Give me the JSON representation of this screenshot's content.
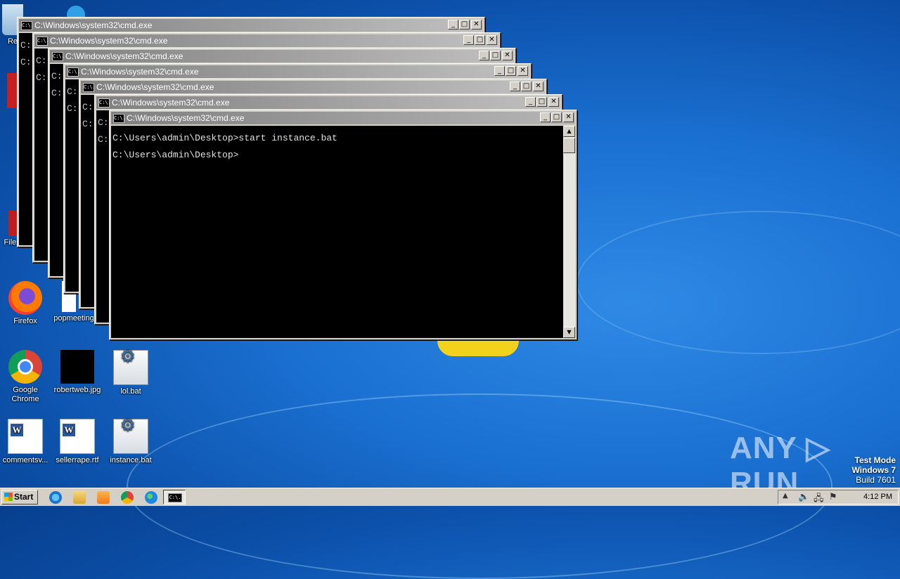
{
  "desktop": {
    "icons": [
      {
        "label": "Re",
        "glyph": "recycle-bin-icon"
      },
      {
        "label": "Firefox",
        "glyph": "firefox-icon"
      },
      {
        "label": "popmeeting",
        "glyph": "document-icon"
      },
      {
        "label": "Google Chrome",
        "glyph": "chrome-icon"
      },
      {
        "label": "robertweb.jpg",
        "glyph": "image-icon"
      },
      {
        "label": "lol.bat",
        "glyph": "batch-file-icon"
      },
      {
        "label": "commentsv...",
        "glyph": "word-document-icon"
      },
      {
        "label": "sellerrape.rtf",
        "glyph": "word-document-icon"
      },
      {
        "label": "instance.bat",
        "glyph": "batch-file-icon"
      },
      {
        "label": "FileZilla C",
        "glyph": "filezilla-icon"
      }
    ]
  },
  "windows": {
    "title": "C:\\Windows\\system32\\cmd.exe",
    "icon_text": "C:\\.",
    "minimize": "_",
    "maximize": "□",
    "close": "✕",
    "partial_prompt": "C:",
    "active_lines": [
      "C:\\Users\\admin\\Desktop>start instance.bat",
      "C:\\Users\\admin\\Desktop>"
    ]
  },
  "taskbar": {
    "start_label": "Start",
    "clock": "4:12 PM"
  },
  "watermark": {
    "text": "ANY ▷ RUN"
  },
  "test_mode": {
    "line1": "Test Mode",
    "line2": "Windows 7",
    "line3": "Build 7601"
  },
  "colors": {
    "desktop_blue": "#1a6fd0",
    "console_bg": "#000000",
    "console_fg": "#c0c0c0",
    "titlebar_inactive": "#808080"
  }
}
